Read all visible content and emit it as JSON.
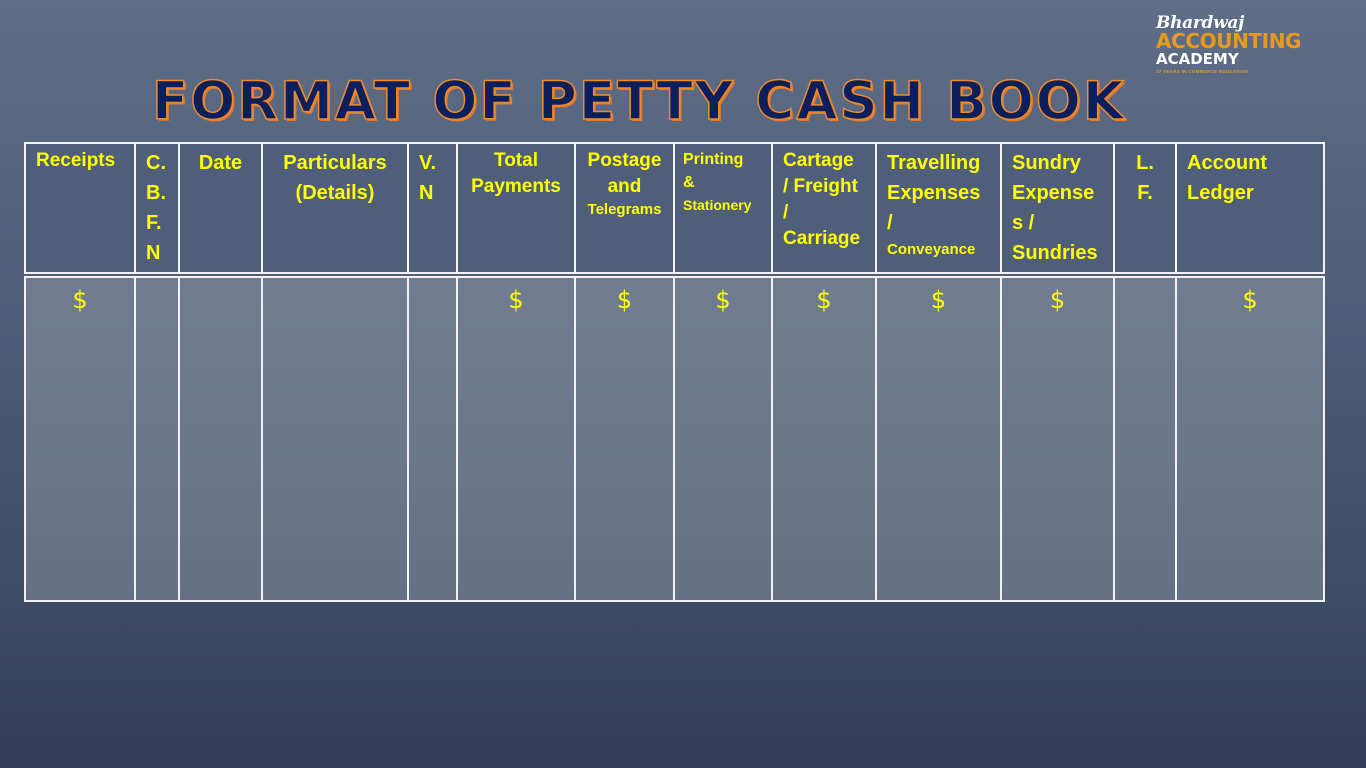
{
  "logo": {
    "script_text": "Bhardwaj",
    "main_text": "ACCOUNTING",
    "sub_text": "ACADEMY",
    "tagline": "27 YEARS IN COMMERCE EDUCATION"
  },
  "title": "FORMAT OF PETTY CASH BOOK",
  "table": {
    "columns": [
      {
        "lines": [
          "Receipts"
        ]
      },
      {
        "lines": [
          "C.",
          "B.",
          "F.",
          "N"
        ]
      },
      {
        "lines": [
          "Date"
        ]
      },
      {
        "lines": [
          "Particulars",
          "(Details)"
        ]
      },
      {
        "lines": [
          "V.",
          "N"
        ]
      },
      {
        "lines": [
          "Total",
          "Payments"
        ]
      },
      {
        "lines": [
          "Postage",
          "and",
          "Telegrams"
        ]
      },
      {
        "lines": [
          "Printing",
          "&",
          "Stationery"
        ]
      },
      {
        "lines": [
          "Cartage",
          "/ Freight",
          "/",
          "Carriage"
        ]
      },
      {
        "lines": [
          "Travelling",
          "Expenses",
          "/",
          "Conveyance"
        ]
      },
      {
        "lines": [
          "Sundry",
          "Expense",
          "s /",
          "Sundries"
        ]
      },
      {
        "lines": [
          "L.",
          "F."
        ]
      },
      {
        "lines": [
          "Account",
          "Ledger"
        ]
      }
    ],
    "row": [
      "$",
      "",
      "",
      "",
      "",
      "$",
      "$",
      "$",
      "$",
      "$",
      "$",
      "",
      "$"
    ]
  },
  "colors": {
    "text_highlight": "#ffff00",
    "title_fill": "#0b1f5c",
    "title_outline": "#f08a2a",
    "logo_accent": "#e89a1e"
  }
}
